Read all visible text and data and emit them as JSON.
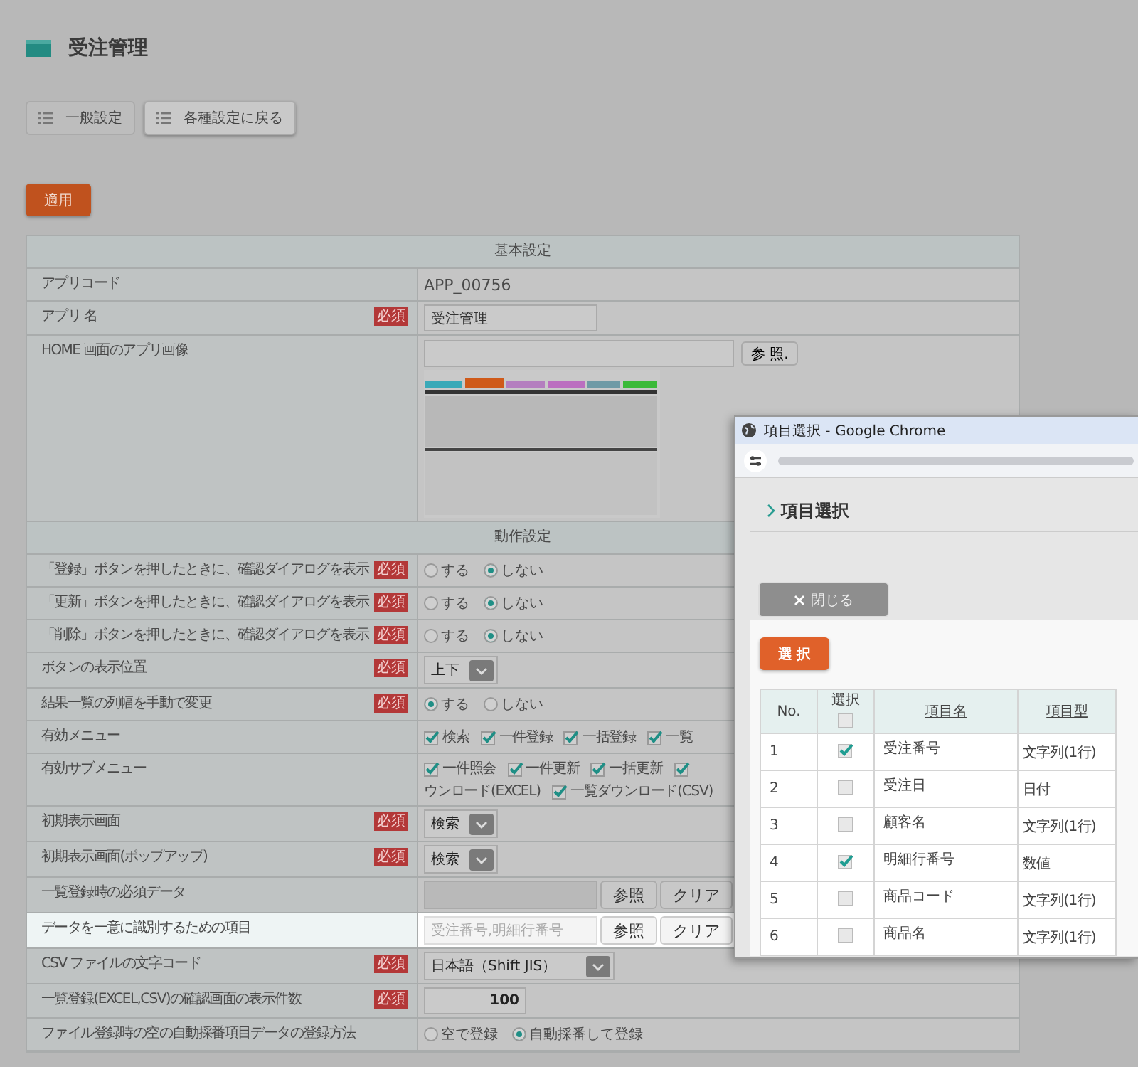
{
  "page": {
    "title": "受注管理"
  },
  "nav_buttons": [
    "一般設定",
    "各種設定に戻る"
  ],
  "apply_button": "適用",
  "sections": [
    {
      "heading": "基本設定",
      "rows": [
        {
          "label": "アプリコード",
          "highlighted": false,
          "kind": "text",
          "value": "APP_00756"
        },
        {
          "label": "アプリ 名",
          "badge": "必須",
          "highlighted": false,
          "kind": "input",
          "value": "受注管理"
        },
        {
          "label": "HOME 画面のアプリ画像",
          "highlighted": false,
          "kind": "file",
          "button": "参 照."
        }
      ]
    },
    {
      "heading": "動作設定",
      "rows": [
        {
          "label": "「登録」ボタンを押したときに、確認ダイアログを表示",
          "badge": "必須",
          "highlighted": false,
          "kind": "radio",
          "options": [
            {
              "label": "する",
              "selected": false
            },
            {
              "label": "しない",
              "selected": true
            }
          ]
        },
        {
          "label": "「更新」ボタンを押したときに、確認ダイアログを表示",
          "badge": "必須",
          "highlighted": false,
          "kind": "radio",
          "options": [
            {
              "label": "する",
              "selected": false
            },
            {
              "label": "しない",
              "selected": true
            }
          ]
        },
        {
          "label": "「削除」ボタンを押したときに、確認ダイアログを表示",
          "badge": "必須",
          "highlighted": false,
          "kind": "radio",
          "options": [
            {
              "label": "する",
              "selected": false
            },
            {
              "label": "しない",
              "selected": true
            }
          ]
        },
        {
          "label": "ボタンの表示位置",
          "badge": "必須",
          "highlighted": false,
          "kind": "select",
          "value": "上下"
        },
        {
          "label": "結果一覧の列幅を手動で変更",
          "badge": "必須",
          "highlighted": false,
          "kind": "radio",
          "options": [
            {
              "label": "する",
              "selected": true
            },
            {
              "label": "しない",
              "selected": false
            }
          ]
        },
        {
          "label": "有効メニュー",
          "highlighted": false,
          "kind": "checks",
          "lines": [
            [
              {
                "kind": "check",
                "label": "検索",
                "checked": true
              },
              {
                "kind": "check",
                "label": "一件登録",
                "checked": true
              },
              {
                "kind": "check",
                "label": "一括登録",
                "checked": true
              },
              {
                "kind": "check",
                "label": "一覧",
                "checked": true
              }
            ]
          ]
        },
        {
          "label": "有効サブメニュー",
          "highlighted": false,
          "kind": "checks",
          "lines": [
            [
              {
                "kind": "check",
                "label": "一件照会",
                "checked": true
              },
              {
                "kind": "check",
                "label": "一件更新",
                "checked": true
              },
              {
                "kind": "check",
                "label": "一括更新",
                "checked": true
              },
              {
                "kind": "check",
                "checked": true
              }
            ],
            [
              {
                "kind": "text",
                "label": "ウンロード(EXCEL)"
              },
              {
                "kind": "check",
                "label": "一覧ダウンロード(CSV)",
                "checked": true
              }
            ]
          ]
        },
        {
          "label": "初期表示画面",
          "badge": "必須",
          "highlighted": false,
          "kind": "select",
          "value": "検索"
        },
        {
          "label": "初期表示画面(ポップアップ)",
          "badge": "必須",
          "highlighted": false,
          "kind": "select",
          "value": "検索"
        },
        {
          "label": "一覧登録時の必須データ",
          "highlighted": false,
          "kind": "ref",
          "buttons": [
            "参照",
            "クリア"
          ]
        },
        {
          "label": "データを一意に識別するための項目",
          "highlighted": true,
          "kind": "ref",
          "placeholder": "受注番号,明細行番号",
          "buttons": [
            "参照",
            "クリア"
          ]
        },
        {
          "label": "CSV ファイルの文字コード",
          "badge": "必須",
          "highlighted": false,
          "kind": "select",
          "value": "日本語（Shift JIS）"
        },
        {
          "label": "一覧登録(EXCEL,CSV)の確認画面の表示件数",
          "badge": "必須",
          "highlighted": false,
          "kind": "number",
          "value": "100"
        },
        {
          "label": "ファイル登録時の空の自動採番項目データの登録方法",
          "highlighted": false,
          "kind": "radio",
          "options": [
            {
              "label": "空で登録",
              "selected": false
            },
            {
              "label": "自動採番して登録",
              "selected": true
            }
          ]
        }
      ]
    }
  ],
  "popup": {
    "window_title": "項目選択 - Google Chrome",
    "heading": "項目選択",
    "close_button": "閉じる",
    "select_button": "選 択",
    "columns": [
      {
        "label": "No.",
        "link": false
      },
      {
        "label": "選択",
        "link": false
      },
      {
        "label": "項目名",
        "link": true
      },
      {
        "label": "項目型",
        "link": true
      }
    ],
    "all_checked": false,
    "rows": [
      {
        "no": "1",
        "checked": true,
        "name": "受注番号",
        "type": "文字列(1行)"
      },
      {
        "no": "2",
        "checked": false,
        "name": "受注日",
        "type": "日付"
      },
      {
        "no": "3",
        "checked": false,
        "name": "顧客名",
        "type": "文字列(1行)"
      },
      {
        "no": "4",
        "checked": true,
        "name": "明細行番号",
        "type": "数値"
      },
      {
        "no": "5",
        "checked": false,
        "name": "商品コード",
        "type": "文字列(1行)"
      },
      {
        "no": "6",
        "checked": false,
        "name": "商品名",
        "type": "文字列(1行)"
      }
    ]
  }
}
